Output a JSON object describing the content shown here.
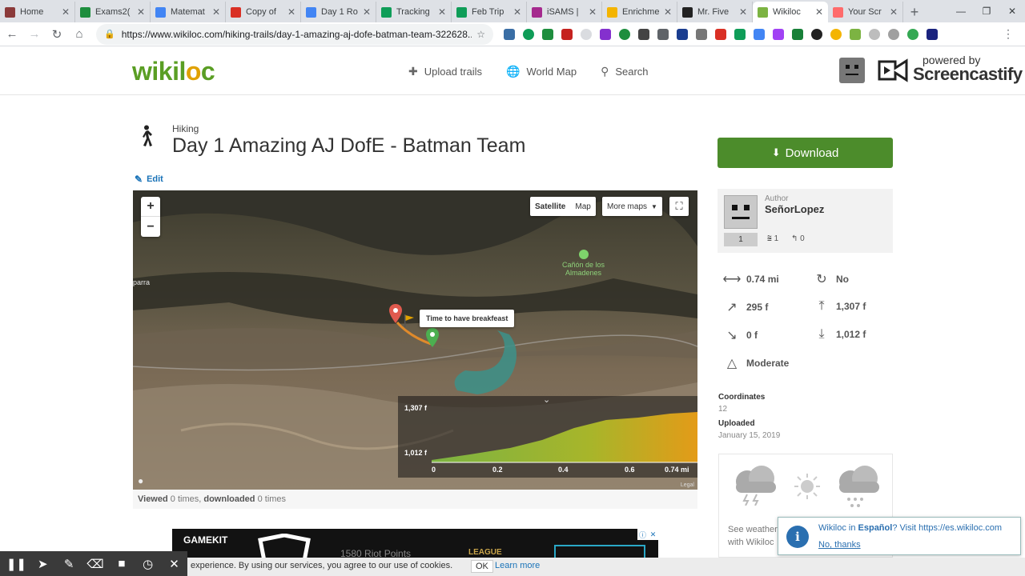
{
  "browser": {
    "tabs": [
      {
        "label": "Home",
        "color": "#8b3a3a"
      },
      {
        "label": "Exams2(",
        "color": "#1e8e3e"
      },
      {
        "label": "Matemat",
        "color": "#4285f4"
      },
      {
        "label": "Copy of",
        "color": "#d93025"
      },
      {
        "label": "Day 1 Ro",
        "color": "#4285f4"
      },
      {
        "label": "Tracking",
        "color": "#0f9d58"
      },
      {
        "label": "Feb Trip",
        "color": "#0f9d58"
      },
      {
        "label": "iSAMS |",
        "color": "#a52a8e"
      },
      {
        "label": "Enrichme",
        "color": "#f4b400"
      },
      {
        "label": "Mr. Five",
        "color": "#222222"
      },
      {
        "label": "Wikiloc",
        "color": "#7cb342",
        "active": true
      },
      {
        "label": "Your Scr",
        "color": "#ff6b6b"
      }
    ],
    "url": "https://www.wikiloc.com/hiking-trails/day-1-amazing-aj-dofe-batman-team-322628..."
  },
  "site": {
    "logo_text": "wikil",
    "logo_o": "o",
    "logo_end": "c",
    "nav": [
      {
        "label": "Upload trails",
        "icon": "plus-icon"
      },
      {
        "label": "World Map",
        "icon": "globe-icon"
      },
      {
        "label": "Search",
        "icon": "search-icon"
      }
    ]
  },
  "screencastify": {
    "powered": "powered by",
    "brand": "Screencastify"
  },
  "trail": {
    "category": "Hiking",
    "title": "Day 1 Amazing AJ DofE - Batman Team",
    "edit_label": "Edit",
    "viewed_label": "Viewed",
    "viewed_count": "0 times,",
    "downloaded_label": "downloaded",
    "downloaded_count": "0 times"
  },
  "map": {
    "satellite": "Satellite",
    "map": "Map",
    "more_maps": "More maps",
    "zoom_in": "+",
    "zoom_out": "−",
    "place_parra": "parra",
    "place_canyon_1": "Cañón de los",
    "place_canyon_2": "Almadenes",
    "tooltip": "Time to have breakfeast",
    "legal": "Legal",
    "elevation": {
      "max": "1,307 f",
      "min": "1,012 f",
      "x_ticks": [
        "0",
        "0.2",
        "0.4",
        "0.6",
        "0.74 mi"
      ]
    }
  },
  "sidebar": {
    "download_label": "Download",
    "author_label": "Author",
    "author_name": "SeñorLopez",
    "author_rank": "1",
    "author_followers": "1",
    "author_following": "0",
    "stats": {
      "distance": "0.74 mi",
      "loop": "No",
      "elev_gain": "295 f",
      "max_elev": "1,307 f",
      "elev_loss": "0 f",
      "min_elev": "1,012 f",
      "difficulty": "Moderate"
    },
    "coordinates_label": "Coordinates",
    "coordinates_value": "12",
    "uploaded_label": "Uploaded",
    "uploaded_value": "January 15, 2019",
    "weather_text_1": "See weather",
    "weather_text_2": "with Wikiloc"
  },
  "notification": {
    "text_pre": "Wikiloc in",
    "text_lang": "Español",
    "text_mid": "? Visit",
    "text_url": "https://es.wikiloc.com",
    "no_thanks": "No, thanks"
  },
  "ad": {
    "brand": "GAMEKIT",
    "points": "1580 Riot Points",
    "league": "LEAGUE"
  },
  "cookie": {
    "text": "experience. By using our services, you agree to our use of cookies.",
    "ok": "OK",
    "learn_more": "Learn more"
  }
}
